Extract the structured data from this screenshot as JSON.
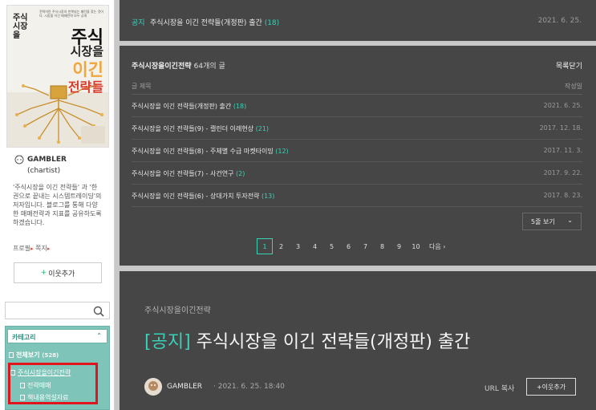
{
  "book": {
    "top_text": "전략이란 주식시장의 반복되는 패턴을 찾는 것이다. 시장을 이긴 매매전략 모두 공개",
    "vertical_title": "주식시장을",
    "line1": "주식",
    "line2": "시장을",
    "line3": "이긴",
    "line4": "전략들"
  },
  "profile": {
    "name": "GAMBLER",
    "subtitle": "(chartist)",
    "description": "'주식시장을 이긴 전략들' 과 '한 권으로 끝내는 시스템트레이딩'의 저자입니다. 블로그를 통해 다양한 매매전략과 지표를 공유하도록 하겠습니다.",
    "link_profile": "프로필",
    "link_note": "쪽지",
    "add_neighbor": "이웃추가"
  },
  "category": {
    "title": "카테고리",
    "all_label": "전체보기",
    "all_count": "(528)",
    "items": [
      {
        "label": "주식시장을이긴전략"
      },
      {
        "label": "전략매매"
      },
      {
        "label": "책내용역설자료"
      }
    ]
  },
  "notice": {
    "label": "공지",
    "title": "주식시장을 이긴 전략들(개정판) 출간",
    "count": "(18)",
    "date": "2021. 6. 25."
  },
  "list": {
    "category_name": "주식시장을이긴전략",
    "post_count": "64개의 글",
    "close_label": "목록닫기",
    "col_title": "글 제목",
    "col_date": "작성일",
    "rows": [
      {
        "title": "주식시장을 이긴 전략들(개정판) 출간",
        "count": "(18)",
        "date": "2021. 6. 25."
      },
      {
        "title": "주식시장을 이긴 전략들(9) - 캘린더 이례현상",
        "count": "(21)",
        "date": "2017. 12. 18."
      },
      {
        "title": "주식시장을 이긴 전략들(8) - 주체별 수급 마켓타이밍",
        "count": "(12)",
        "date": "2017. 11. 3."
      },
      {
        "title": "주식시장을 이긴 전략들(7) - 사건연구",
        "count": "(2)",
        "date": "2017. 9. 22."
      },
      {
        "title": "주식시장을 이긴 전략들(6) - 상대가치 투자전략",
        "count": "(13)",
        "date": "2017. 8. 23."
      }
    ],
    "per_page_label": "5줄 보기",
    "pages": [
      "1",
      "2",
      "3",
      "4",
      "5",
      "6",
      "7",
      "8",
      "9",
      "10"
    ],
    "next_label": "다음"
  },
  "post": {
    "category": "주식시장을이긴전략",
    "title_label": "[공지]",
    "title": "주식시장을 이긴 전략들(개정판) 출간",
    "author": "GAMBLER",
    "date": "· 2021. 6. 25. 18:40",
    "url_copy": "URL 복사",
    "add_neighbor": "+이웃추가"
  },
  "colors": {
    "accent": "#38d2b7",
    "panel_bg": "#464646",
    "sidebar_category_bg": "#7ec4b8",
    "highlight_box": "#e1141e"
  }
}
